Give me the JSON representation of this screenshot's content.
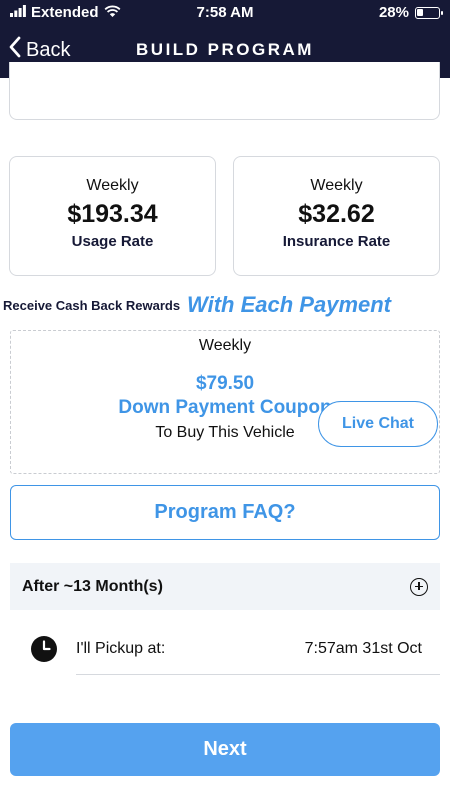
{
  "status_bar": {
    "carrier": "Extended",
    "time": "7:58 AM",
    "battery_percent": "28%",
    "battery_level": 0.28,
    "icons": [
      "signal-icon",
      "wifi-icon",
      "battery-icon"
    ]
  },
  "header": {
    "back_label": "Back",
    "title": "BUILD PROGRAM"
  },
  "rates": {
    "usage": {
      "period": "Weekly",
      "amount": "$193.34",
      "label": "Usage Rate"
    },
    "insurance": {
      "period": "Weekly",
      "amount": "$32.62",
      "label": "Insurance Rate"
    }
  },
  "rewards": {
    "text": "Receive Cash Back Rewards",
    "emphasis": "With Each Payment"
  },
  "down_payment": {
    "period": "Weekly",
    "amount": "$79.50",
    "label": "Down Payment Coupon",
    "subtext": "To Buy This Vehicle"
  },
  "live_chat_label": "Live Chat",
  "faq_label": "Program FAQ?",
  "after": {
    "label": "After ~13 Month(s)"
  },
  "pickup": {
    "label": "I'll Pickup at:",
    "value": "7:57am 31st Oct"
  },
  "next_label": "Next",
  "colors": {
    "header_bg": "#161936",
    "accent_blue": "#3f95e6",
    "next_button": "#55a2ef",
    "after_bar_bg": "#f1f4f8"
  }
}
